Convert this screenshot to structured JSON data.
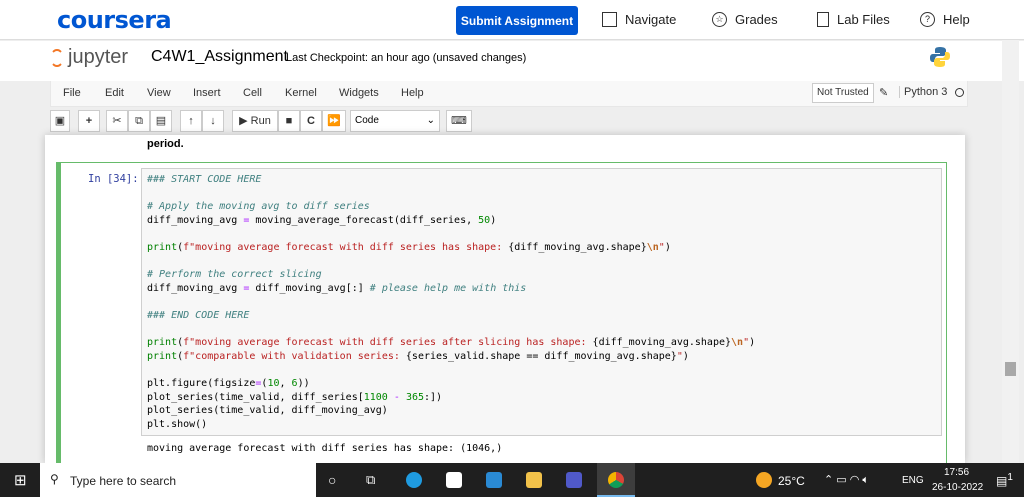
{
  "coursera": {
    "logo": "coursera",
    "submit": "Submit Assignment",
    "nav": [
      "Navigate",
      "Grades",
      "Lab Files",
      "Help"
    ]
  },
  "jupyter": {
    "logo": "jupyter",
    "name": "C4W1_Assignment",
    "checkpoint": "Last Checkpoint: an hour ago  (unsaved changes)"
  },
  "menu": [
    "File",
    "Edit",
    "View",
    "Insert",
    "Cell",
    "Kernel",
    "Widgets",
    "Help"
  ],
  "trust": "Not Trusted",
  "kernel": "Python 3",
  "toolbar": {
    "run": "Run",
    "cell_type": "Code"
  },
  "prev_text": "period.",
  "cell": {
    "prompt": "In [34]:",
    "lines": [
      [
        [
          "cm",
          "### START CODE HERE"
        ]
      ],
      [],
      [
        [
          "cm",
          "# Apply the moving avg to diff series"
        ]
      ],
      [
        [
          "",
          "diff_moving_avg "
        ],
        [
          "op",
          "="
        ],
        [
          "",
          " moving_average_forecast(diff_series, "
        ],
        [
          "nu",
          "50"
        ],
        [
          "",
          ")"
        ]
      ],
      [],
      [
        [
          "kw",
          "print"
        ],
        [
          "",
          "("
        ],
        [
          "st",
          "f\"moving average forecast with diff series has shape: "
        ],
        [
          "",
          "{diff_moving_avg.shape}"
        ],
        [
          "es",
          "\\n"
        ],
        [
          "st",
          "\""
        ],
        [
          "",
          ")"
        ]
      ],
      [],
      [
        [
          "cm",
          "# Perform the correct slicing"
        ]
      ],
      [
        [
          "",
          "diff_moving_avg "
        ],
        [
          "op",
          "="
        ],
        [
          "",
          " diff_moving_avg[:] "
        ],
        [
          "cm",
          "# please help me with this"
        ]
      ],
      [],
      [
        [
          "cm",
          "### END CODE HERE"
        ]
      ],
      [],
      [
        [
          "kw",
          "print"
        ],
        [
          "",
          "("
        ],
        [
          "st",
          "f\"moving average forecast with diff series after slicing has shape: "
        ],
        [
          "",
          "{diff_moving_avg.shape}"
        ],
        [
          "es",
          "\\n"
        ],
        [
          "st",
          "\""
        ],
        [
          "",
          ")"
        ]
      ],
      [
        [
          "kw",
          "print"
        ],
        [
          "",
          "("
        ],
        [
          "st",
          "f\"comparable with validation series: "
        ],
        [
          "",
          "{series_valid.shape == diff_moving_avg.shape}"
        ],
        [
          "st",
          "\""
        ],
        [
          "",
          ")"
        ]
      ],
      [],
      [
        [
          "",
          "plt.figure(figsize"
        ],
        [
          "op",
          "="
        ],
        [
          "",
          "("
        ],
        [
          "nu",
          "10"
        ],
        [
          "",
          ", "
        ],
        [
          "nu",
          "6"
        ],
        [
          "",
          "))"
        ]
      ],
      [
        [
          "",
          "plot_series(time_valid, diff_series["
        ],
        [
          "nu",
          "1100"
        ],
        [
          "",
          " "
        ],
        [
          "op",
          "-"
        ],
        [
          "",
          " "
        ],
        [
          "nu",
          "365"
        ],
        [
          "",
          ":])"
        ]
      ],
      [
        [
          "",
          "plot_series(time_valid, diff_moving_avg)"
        ]
      ],
      [
        [
          "",
          "plt.show()"
        ]
      ]
    ],
    "output": "moving average forecast with diff series has shape: (1046,)"
  },
  "taskbar": {
    "search": "Type here to search",
    "temp": "25°C",
    "lang": "ENG",
    "time": "17:56",
    "date": "26-10-2022",
    "notif": "1"
  }
}
